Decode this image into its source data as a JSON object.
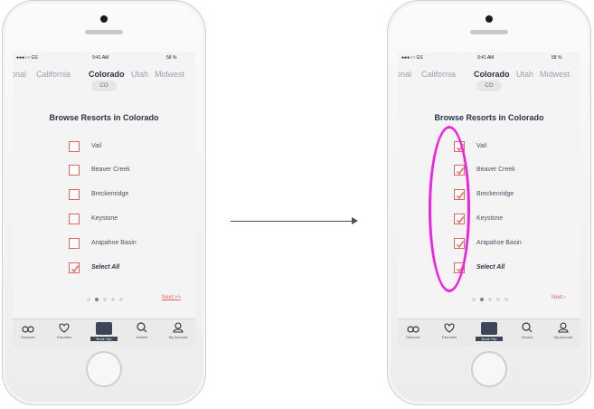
{
  "status": {
    "carrier": "●●●○○ GS",
    "time": "9:41 AM",
    "battery": "58 %"
  },
  "tabs": [
    "ional",
    "California",
    "Colorado",
    "Utah",
    "Midwest"
  ],
  "badge": "CO",
  "heading": "Browse Resorts in Colorado",
  "resorts": [
    "Vail",
    "Beaver Creek",
    "Breckenridge",
    "Keystone",
    "Arapahoe Basin"
  ],
  "select_all": "Select All",
  "next_left": "Next >>",
  "next_right": "Next  ›",
  "tabbar": [
    "Discover",
    "Favorites",
    "Book Trip",
    "Search",
    "My Account"
  ],
  "colors": {
    "accent": "#e2645f",
    "highlight": "#f022e0",
    "navy": "#2a3344"
  }
}
